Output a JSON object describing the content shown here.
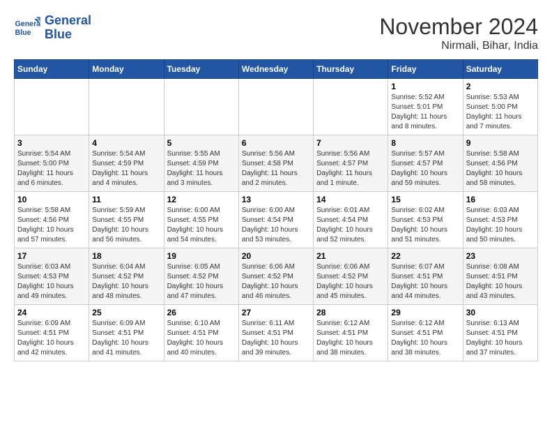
{
  "logo": {
    "brand1": "General",
    "brand2": "Blue"
  },
  "title": "November 2024",
  "location": "Nirmali, Bihar, India",
  "weekdays": [
    "Sunday",
    "Monday",
    "Tuesday",
    "Wednesday",
    "Thursday",
    "Friday",
    "Saturday"
  ],
  "weeks": [
    [
      {
        "day": "",
        "info": ""
      },
      {
        "day": "",
        "info": ""
      },
      {
        "day": "",
        "info": ""
      },
      {
        "day": "",
        "info": ""
      },
      {
        "day": "",
        "info": ""
      },
      {
        "day": "1",
        "info": "Sunrise: 5:52 AM\nSunset: 5:01 PM\nDaylight: 11 hours and 8 minutes."
      },
      {
        "day": "2",
        "info": "Sunrise: 5:53 AM\nSunset: 5:00 PM\nDaylight: 11 hours and 7 minutes."
      }
    ],
    [
      {
        "day": "3",
        "info": "Sunrise: 5:54 AM\nSunset: 5:00 PM\nDaylight: 11 hours and 6 minutes."
      },
      {
        "day": "4",
        "info": "Sunrise: 5:54 AM\nSunset: 4:59 PM\nDaylight: 11 hours and 4 minutes."
      },
      {
        "day": "5",
        "info": "Sunrise: 5:55 AM\nSunset: 4:59 PM\nDaylight: 11 hours and 3 minutes."
      },
      {
        "day": "6",
        "info": "Sunrise: 5:56 AM\nSunset: 4:58 PM\nDaylight: 11 hours and 2 minutes."
      },
      {
        "day": "7",
        "info": "Sunrise: 5:56 AM\nSunset: 4:57 PM\nDaylight: 11 hours and 1 minute."
      },
      {
        "day": "8",
        "info": "Sunrise: 5:57 AM\nSunset: 4:57 PM\nDaylight: 10 hours and 59 minutes."
      },
      {
        "day": "9",
        "info": "Sunrise: 5:58 AM\nSunset: 4:56 PM\nDaylight: 10 hours and 58 minutes."
      }
    ],
    [
      {
        "day": "10",
        "info": "Sunrise: 5:58 AM\nSunset: 4:56 PM\nDaylight: 10 hours and 57 minutes."
      },
      {
        "day": "11",
        "info": "Sunrise: 5:59 AM\nSunset: 4:55 PM\nDaylight: 10 hours and 56 minutes."
      },
      {
        "day": "12",
        "info": "Sunrise: 6:00 AM\nSunset: 4:55 PM\nDaylight: 10 hours and 54 minutes."
      },
      {
        "day": "13",
        "info": "Sunrise: 6:00 AM\nSunset: 4:54 PM\nDaylight: 10 hours and 53 minutes."
      },
      {
        "day": "14",
        "info": "Sunrise: 6:01 AM\nSunset: 4:54 PM\nDaylight: 10 hours and 52 minutes."
      },
      {
        "day": "15",
        "info": "Sunrise: 6:02 AM\nSunset: 4:53 PM\nDaylight: 10 hours and 51 minutes."
      },
      {
        "day": "16",
        "info": "Sunrise: 6:03 AM\nSunset: 4:53 PM\nDaylight: 10 hours and 50 minutes."
      }
    ],
    [
      {
        "day": "17",
        "info": "Sunrise: 6:03 AM\nSunset: 4:53 PM\nDaylight: 10 hours and 49 minutes."
      },
      {
        "day": "18",
        "info": "Sunrise: 6:04 AM\nSunset: 4:52 PM\nDaylight: 10 hours and 48 minutes."
      },
      {
        "day": "19",
        "info": "Sunrise: 6:05 AM\nSunset: 4:52 PM\nDaylight: 10 hours and 47 minutes."
      },
      {
        "day": "20",
        "info": "Sunrise: 6:06 AM\nSunset: 4:52 PM\nDaylight: 10 hours and 46 minutes."
      },
      {
        "day": "21",
        "info": "Sunrise: 6:06 AM\nSunset: 4:52 PM\nDaylight: 10 hours and 45 minutes."
      },
      {
        "day": "22",
        "info": "Sunrise: 6:07 AM\nSunset: 4:51 PM\nDaylight: 10 hours and 44 minutes."
      },
      {
        "day": "23",
        "info": "Sunrise: 6:08 AM\nSunset: 4:51 PM\nDaylight: 10 hours and 43 minutes."
      }
    ],
    [
      {
        "day": "24",
        "info": "Sunrise: 6:09 AM\nSunset: 4:51 PM\nDaylight: 10 hours and 42 minutes."
      },
      {
        "day": "25",
        "info": "Sunrise: 6:09 AM\nSunset: 4:51 PM\nDaylight: 10 hours and 41 minutes."
      },
      {
        "day": "26",
        "info": "Sunrise: 6:10 AM\nSunset: 4:51 PM\nDaylight: 10 hours and 40 minutes."
      },
      {
        "day": "27",
        "info": "Sunrise: 6:11 AM\nSunset: 4:51 PM\nDaylight: 10 hours and 39 minutes."
      },
      {
        "day": "28",
        "info": "Sunrise: 6:12 AM\nSunset: 4:51 PM\nDaylight: 10 hours and 38 minutes."
      },
      {
        "day": "29",
        "info": "Sunrise: 6:12 AM\nSunset: 4:51 PM\nDaylight: 10 hours and 38 minutes."
      },
      {
        "day": "30",
        "info": "Sunrise: 6:13 AM\nSunset: 4:51 PM\nDaylight: 10 hours and 37 minutes."
      }
    ]
  ]
}
